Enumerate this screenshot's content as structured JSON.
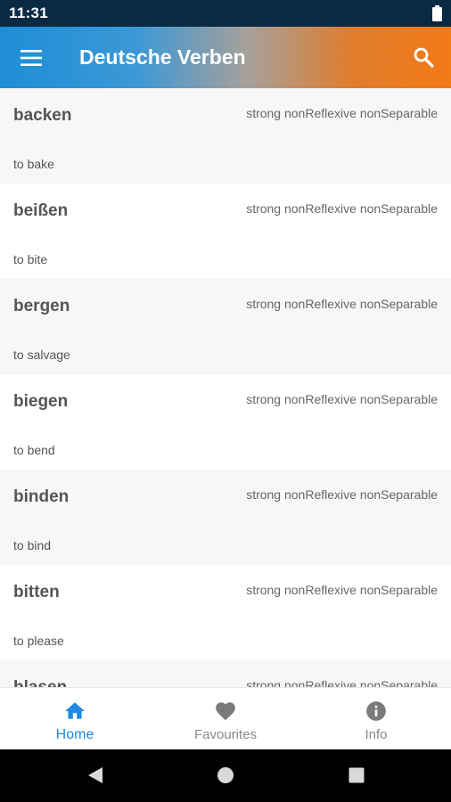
{
  "status_bar": {
    "time": "11:31",
    "battery_icon": "battery-full-icon"
  },
  "app_bar": {
    "title": "Deutsche Verben",
    "menu_icon": "hamburger-menu-icon",
    "search_icon": "search-icon"
  },
  "verbs": [
    {
      "word": "backen",
      "meta": "strong nonReflexive nonSeparable",
      "translation": "to bake"
    },
    {
      "word": "beißen",
      "meta": "strong nonReflexive nonSeparable",
      "translation": "to bite"
    },
    {
      "word": "bergen",
      "meta": "strong nonReflexive nonSeparable",
      "translation": "to salvage"
    },
    {
      "word": "biegen",
      "meta": "strong nonReflexive nonSeparable",
      "translation": "to bend"
    },
    {
      "word": "binden",
      "meta": "strong nonReflexive nonSeparable",
      "translation": "to bind"
    },
    {
      "word": "bitten",
      "meta": "strong nonReflexive nonSeparable",
      "translation": "to please"
    },
    {
      "word": "blasen",
      "meta": "strong nonReflexive nonSeparable",
      "translation": ""
    }
  ],
  "bottom_nav": {
    "items": [
      {
        "label": "Home",
        "icon": "home-icon",
        "active": true
      },
      {
        "label": "Favourites",
        "icon": "heart-icon",
        "active": false
      },
      {
        "label": "Info",
        "icon": "info-icon",
        "active": false
      }
    ]
  },
  "colors": {
    "accent": "#1e88e5",
    "gradient_start": "#1e8ed6",
    "gradient_end": "#f27a17",
    "inactive": "#8a8a8a"
  },
  "system_nav": {
    "back_icon": "back-triangle-icon",
    "home_icon": "home-circle-icon",
    "recents_icon": "recents-square-icon"
  }
}
